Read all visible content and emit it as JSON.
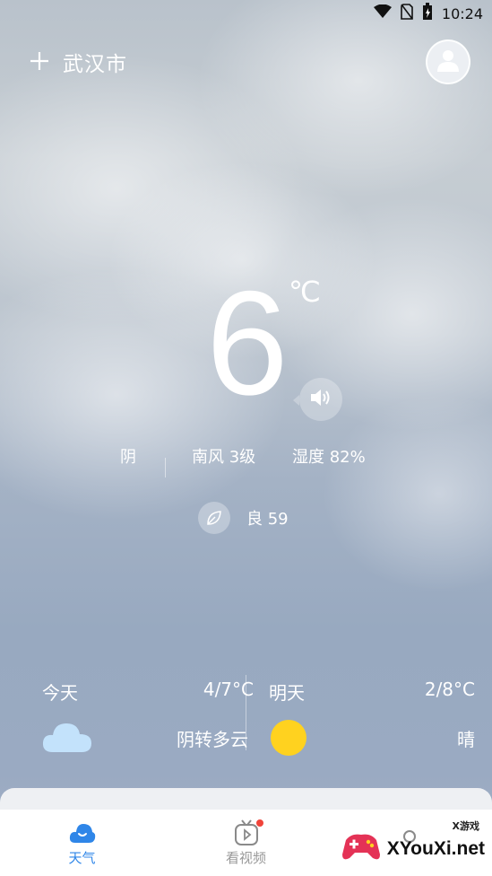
{
  "status_bar": {
    "time": "10:24",
    "icons": [
      "wifi-icon",
      "no-sim-icon",
      "battery-charging-icon"
    ]
  },
  "header": {
    "add_icon": "plus-icon",
    "city": "武汉市",
    "avatar_icon": "user-avatar-icon"
  },
  "current": {
    "temperature": "6",
    "unit": "℃",
    "speaker_icon": "speaker-icon",
    "weather": "阴",
    "wind": "南风 3级",
    "humidity": "湿度 82%",
    "aqi_icon": "leaf-icon",
    "aqi": "良 59"
  },
  "forecast": {
    "today": {
      "label": "今天",
      "range": "4/7°C",
      "condition": "阴转多云",
      "icon": "cloud-icon"
    },
    "tomorrow": {
      "label": "明天",
      "range": "2/8°C",
      "condition": "晴",
      "icon": "sun-icon"
    }
  },
  "nav": {
    "items": [
      {
        "label": "天气",
        "icon": "weather-cloud-icon",
        "active": true
      },
      {
        "label": "看视频",
        "icon": "video-tv-icon",
        "active": false
      },
      {
        "label": "",
        "icon": "search-icon",
        "active": false
      }
    ]
  },
  "watermark": {
    "text": "XYouXi.net",
    "sub": "X游戏"
  },
  "colors": {
    "accent": "#2f86e8",
    "sun": "#ffd21f",
    "cloud": "#bfe0fb"
  }
}
